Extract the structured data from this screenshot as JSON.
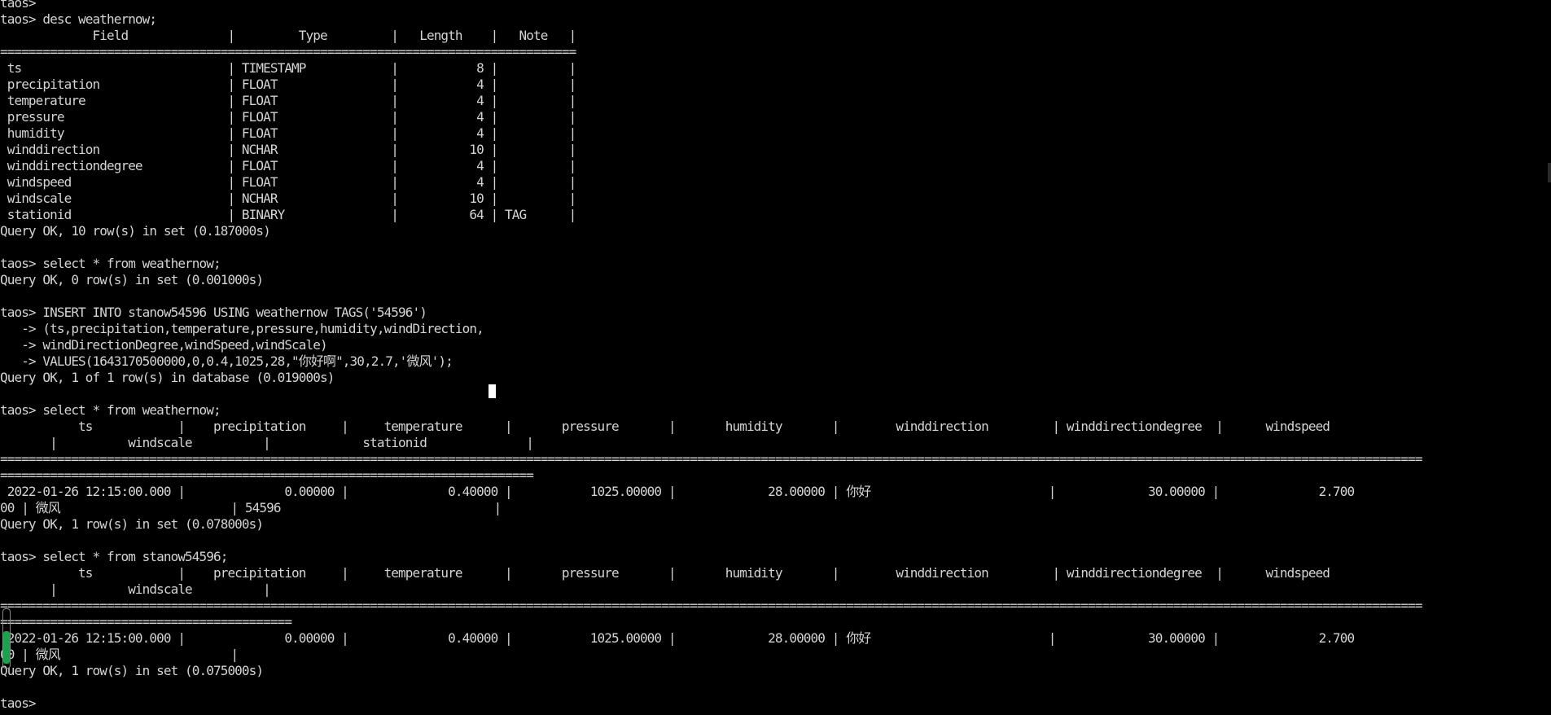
{
  "terminal": {
    "lines": [
      "taos>",
      "taos> desc weathernow;",
      "             Field              |         Type         |   Length    |   Note   |",
      "=================================================================================",
      " ts                             | TIMESTAMP            |           8 |          |",
      " precipitation                  | FLOAT                |           4 |          |",
      " temperature                    | FLOAT                |           4 |          |",
      " pressure                       | FLOAT                |           4 |          |",
      " humidity                       | FLOAT                |           4 |          |",
      " winddirection                  | NCHAR                |          10 |          |",
      " winddirectiondegree            | FLOAT                |           4 |          |",
      " windspeed                      | FLOAT                |           4 |          |",
      " windscale                      | NCHAR                |          10 |          |",
      " stationid                      | BINARY               |          64 | TAG      |",
      "Query OK, 10 row(s) in set (0.187000s)",
      "",
      "taos> select * from weathernow;",
      "Query OK, 0 row(s) in set (0.001000s)",
      "",
      "taos> INSERT INTO stanow54596 USING weathernow TAGS('54596')",
      "   -> (ts,precipitation,temperature,pressure,humidity,windDirection,",
      "   -> windDirectionDegree,windSpeed,windScale)",
      "   -> VALUES(1643170500000,0,0.4,1025,28,\"你好啊\",30,2.7,'微风');",
      "Query OK, 1 of 1 row(s) in database (0.019000s)",
      "",
      "taos> select * from weathernow;",
      "           ts            |    precipitation     |     temperature      |       pressure       |       humidity       |        winddirection         | winddirectiondegree  |      windspeed",
      "       |          windscale          |             stationid              |",
      "========================================================================================================================================================================================================",
      "===========================================================================",
      " 2022-01-26 12:15:00.000 |              0.00000 |              0.40000 |           1025.00000 |             28.00000 | 你好                         |             30.00000 |              2.700",
      "00 | 微风                        | 54596                              |",
      "Query OK, 1 row(s) in set (0.078000s)",
      "",
      "taos> select * from stanow54596;",
      "           ts            |    precipitation     |     temperature      |       pressure       |       humidity       |        winddirection         | winddirectiondegree  |      windspeed",
      "       |          windscale          |",
      "========================================================================================================================================================================================================",
      "=========================================",
      " 2022-01-26 12:15:00.000 |              0.00000 |              0.40000 |           1025.00000 |             28.00000 | 你好                         |             30.00000 |              2.700",
      "00 | 微风                        |",
      "Query OK, 1 row(s) in set (0.075000s)",
      "",
      "taos>"
    ]
  },
  "colors": {
    "background": "#000000",
    "text": "#d4d4d4",
    "cursor": "#ffffff",
    "selection_indicator": "#16a34a"
  }
}
